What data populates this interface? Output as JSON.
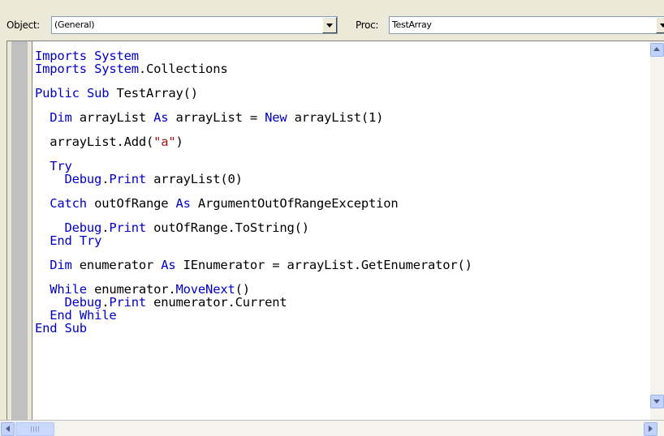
{
  "toolbar": {
    "object_label": "Object:",
    "object_value": "(General)",
    "proc_label": "Proc:",
    "proc_value": "TestArray"
  },
  "code_lines": [
    {
      "indent": 0,
      "parts": [
        {
          "t": "Imports",
          "c": "kw"
        },
        {
          "t": " "
        },
        {
          "t": "System",
          "c": "kw"
        }
      ]
    },
    {
      "indent": 0,
      "parts": [
        {
          "t": "Imports",
          "c": "kw"
        },
        {
          "t": " "
        },
        {
          "t": "System",
          "c": "kw"
        },
        {
          "t": ".Collections"
        }
      ]
    },
    {
      "spacer": true
    },
    {
      "indent": 0,
      "parts": [
        {
          "t": "Public",
          "c": "kw"
        },
        {
          "t": " "
        },
        {
          "t": "Sub",
          "c": "kw"
        },
        {
          "t": " TestArray()"
        }
      ]
    },
    {
      "spacer": true
    },
    {
      "indent": 2,
      "parts": [
        {
          "t": "Dim",
          "c": "kw"
        },
        {
          "t": " arrayList "
        },
        {
          "t": "As",
          "c": "kw"
        },
        {
          "t": " arrayList = "
        },
        {
          "t": "New",
          "c": "kw"
        },
        {
          "t": " arrayList(1)"
        }
      ]
    },
    {
      "spacer": true
    },
    {
      "indent": 2,
      "parts": [
        {
          "t": "arrayList.Add("
        },
        {
          "t": "\"a\"",
          "c": "str"
        },
        {
          "t": ")"
        }
      ]
    },
    {
      "spacer": true
    },
    {
      "indent": 2,
      "parts": [
        {
          "t": "Try",
          "c": "kw"
        }
      ]
    },
    {
      "indent": 4,
      "parts": [
        {
          "t": "Debug",
          "c": "kw"
        },
        {
          "t": "."
        },
        {
          "t": "Print",
          "c": "kw"
        },
        {
          "t": " arrayList(0)"
        }
      ]
    },
    {
      "spacer": true
    },
    {
      "indent": 2,
      "parts": [
        {
          "t": "Catch",
          "c": "kw"
        },
        {
          "t": " outOfRange "
        },
        {
          "t": "As",
          "c": "kw"
        },
        {
          "t": " ArgumentOutOfRangeException"
        }
      ]
    },
    {
      "spacer": true
    },
    {
      "indent": 4,
      "parts": [
        {
          "t": "Debug",
          "c": "kw"
        },
        {
          "t": "."
        },
        {
          "t": "Print",
          "c": "kw"
        },
        {
          "t": " outOfRange.ToString()"
        }
      ]
    },
    {
      "indent": 2,
      "parts": [
        {
          "t": "End",
          "c": "kw"
        },
        {
          "t": " "
        },
        {
          "t": "Try",
          "c": "kw"
        }
      ]
    },
    {
      "spacer": true
    },
    {
      "indent": 2,
      "parts": [
        {
          "t": "Dim",
          "c": "kw"
        },
        {
          "t": " enumerator "
        },
        {
          "t": "As",
          "c": "kw"
        },
        {
          "t": " IEnumerator = arrayList.GetEnumerator()"
        }
      ]
    },
    {
      "spacer": true
    },
    {
      "indent": 2,
      "parts": [
        {
          "t": "While",
          "c": "kw"
        },
        {
          "t": " enumerator."
        },
        {
          "t": "MoveNext",
          "c": "kw"
        },
        {
          "t": "()"
        }
      ]
    },
    {
      "indent": 4,
      "parts": [
        {
          "t": "Debug",
          "c": "kw"
        },
        {
          "t": "."
        },
        {
          "t": "Print",
          "c": "kw"
        },
        {
          "t": " enumerator.Current"
        }
      ]
    },
    {
      "indent": 2,
      "parts": [
        {
          "t": "End",
          "c": "kw"
        },
        {
          "t": " "
        },
        {
          "t": "While",
          "c": "kw"
        }
      ]
    },
    {
      "indent": 0,
      "parts": [
        {
          "t": "End",
          "c": "kw"
        },
        {
          "t": " "
        },
        {
          "t": "Sub",
          "c": "kw"
        }
      ]
    }
  ],
  "icons": {
    "object_dropdown": "chevron-down-icon",
    "proc_dropdown": "chevron-down-icon",
    "scroll_up": "scroll-up-arrow-icon",
    "scroll_down": "scroll-down-arrow-icon",
    "scroll_left": "scroll-left-arrow-icon",
    "scroll_right": "scroll-right-arrow-icon"
  },
  "colors": {
    "keyword": "#0000c8",
    "string": "#a31515",
    "text": "#000000",
    "chrome": "#ece9d8"
  }
}
